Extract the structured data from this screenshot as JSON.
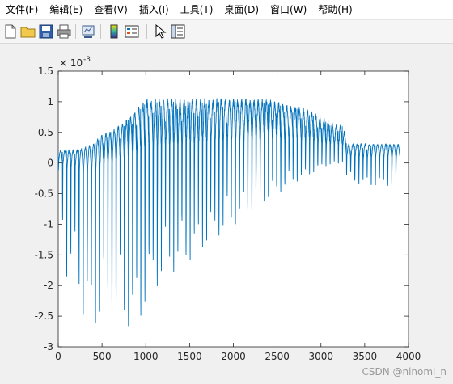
{
  "menu": {
    "items": [
      "文件(F)",
      "编辑(E)",
      "查看(V)",
      "插入(I)",
      "工具(T)",
      "桌面(D)",
      "窗口(W)",
      "帮助(H)"
    ]
  },
  "toolbar": {
    "buttons": [
      "new-figure-icon",
      "open-folder-icon",
      "save-icon",
      "print-icon",
      "link-plot-icon",
      "colorbar-icon",
      "legend-icon",
      "pointer-icon",
      "property-editor-icon"
    ]
  },
  "colors": {
    "line": "#0072bd",
    "axes_bg": "#ffffff",
    "figure_bg": "#f0f0f0"
  },
  "watermark": "CSDN @ninomi_n",
  "chart_data": {
    "type": "line",
    "exponent_label": "× 10^-3",
    "exponent_base": "× 10",
    "exponent_power": "-3",
    "xlim": [
      0,
      4000
    ],
    "ylim": [
      -3,
      1.5
    ],
    "xticks": [
      "0",
      "500",
      "1000",
      "1500",
      "2000",
      "2500",
      "3000",
      "3500",
      "4000"
    ],
    "yticks": [
      "1.5",
      "1",
      "0.5",
      "0",
      "-0.5",
      "-1",
      "-1.5",
      "-2",
      "-2.5",
      "-3"
    ],
    "grid": false,
    "series": [
      {
        "envelope_points_x": [
          0,
          100,
          200,
          300,
          400,
          500,
          600,
          700,
          800,
          900,
          1000,
          1100,
          1200,
          1300,
          1400,
          1500,
          1600,
          1700,
          1800,
          1900,
          2000,
          2100,
          2200,
          2300,
          2400,
          2500,
          2600,
          2700,
          2800,
          2900,
          3000,
          3100,
          3200,
          3250,
          3300,
          3400,
          3500,
          3600,
          3700,
          3800,
          3880
        ],
        "envelope_max": [
          0.2,
          0.2,
          0.2,
          0.25,
          0.3,
          0.45,
          0.5,
          0.6,
          0.7,
          0.85,
          1.0,
          1.0,
          1.0,
          1.0,
          1.0,
          1.0,
          1.0,
          1.0,
          1.0,
          1.0,
          1.0,
          1.0,
          1.0,
          1.0,
          1.0,
          0.95,
          0.92,
          0.9,
          0.85,
          0.8,
          0.72,
          0.65,
          0.6,
          0.6,
          0.3,
          0.3,
          0.3,
          0.3,
          0.3,
          0.3,
          0.3
        ],
        "envelope_min": [
          -0.2,
          -2.0,
          -1.8,
          -2.8,
          -2.8,
          -2.7,
          -2.5,
          -2.8,
          -2.8,
          -3.0,
          -2.4,
          -2.2,
          -2.0,
          -1.9,
          -1.8,
          -1.7,
          -1.6,
          -1.4,
          -1.3,
          -1.2,
          -1.1,
          -0.95,
          -0.85,
          -0.75,
          -0.65,
          -0.55,
          -0.45,
          -0.35,
          -0.3,
          -0.2,
          -0.1,
          -0.05,
          -0.05,
          0.0,
          -0.3,
          -0.35,
          -0.4,
          -0.4,
          -0.4,
          -0.4,
          -0.4
        ],
        "cycle_period": 47,
        "x_end": 3900
      }
    ]
  }
}
